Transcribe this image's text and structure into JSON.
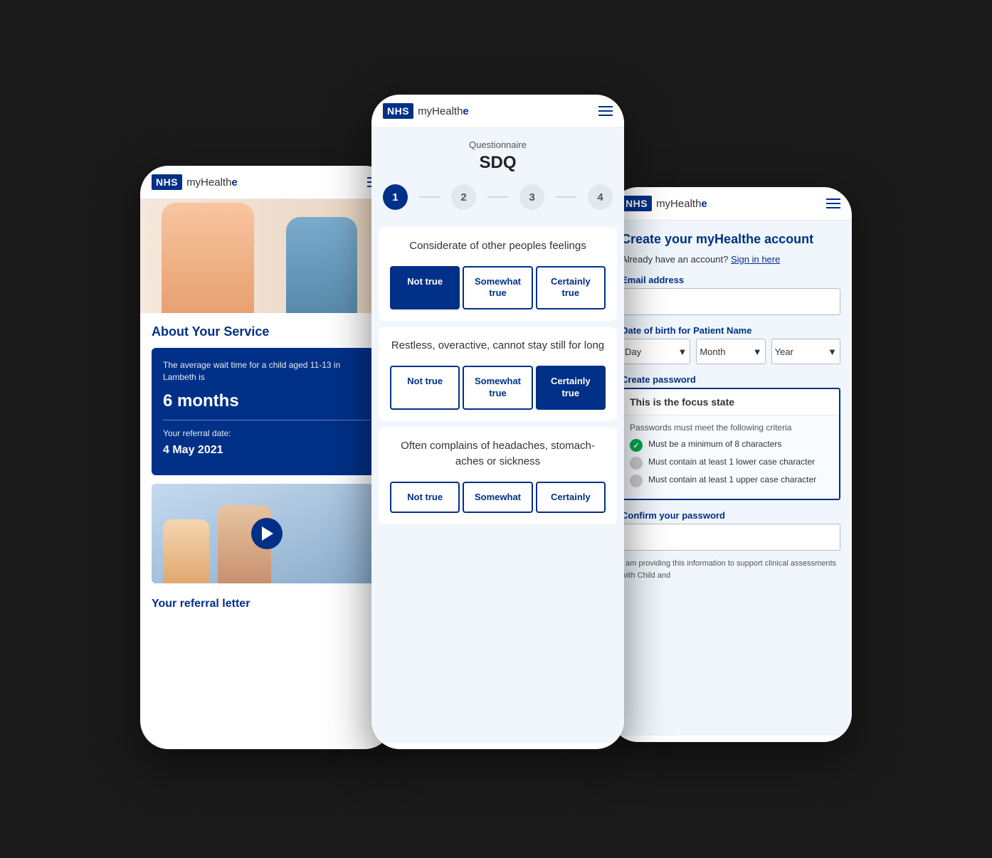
{
  "app": {
    "name": "myHealthe",
    "nhs_badge": "NHS",
    "brand_text": "myHealth",
    "brand_emphasis": "e"
  },
  "phone_left": {
    "header": {
      "logo": "NHS",
      "brand": "myHealthe",
      "menu_icon": "hamburger"
    },
    "about_section": {
      "title": "About Your Service",
      "info_card": {
        "line1": "The average wait time for a child aged 11-13 in Lambeth is",
        "big_value": "6 months",
        "referral_label": "Your referral date:",
        "referral_date": "4 May 2021"
      },
      "referral_link": "Your referral letter"
    }
  },
  "phone_center": {
    "header": {
      "logo": "NHS",
      "brand": "myHealthe",
      "menu_icon": "hamburger"
    },
    "questionnaire": {
      "label": "Questionnaire",
      "title": "SDQ",
      "steps": [
        {
          "number": "1",
          "active": true
        },
        {
          "number": "2",
          "active": false
        },
        {
          "number": "3",
          "active": false
        },
        {
          "number": "4",
          "active": false
        }
      ]
    },
    "questions": [
      {
        "text": "Considerate of other peoples feelings",
        "options": [
          {
            "label": "Not true",
            "selected": true
          },
          {
            "label": "Somewhat true",
            "selected": false
          },
          {
            "label": "Certainly true",
            "selected": false
          }
        ]
      },
      {
        "text": "Restless, overactive, cannot stay still for long",
        "options": [
          {
            "label": "Not true",
            "selected": false
          },
          {
            "label": "Somewhat true",
            "selected": false
          },
          {
            "label": "Certainly true",
            "selected": true
          }
        ]
      },
      {
        "text": "Often complains of headaches, stomach-aches or sickness",
        "options": [
          {
            "label": "Not true",
            "selected": false
          },
          {
            "label": "Somewhat",
            "selected": false
          },
          {
            "label": "Certainly",
            "selected": false
          }
        ]
      }
    ]
  },
  "phone_right": {
    "header": {
      "logo": "NHS",
      "brand": "myHealthe",
      "menu_icon": "hamburger"
    },
    "form": {
      "title": "Create your myHealthe account",
      "subtitle_prefix": "Already have an account?",
      "subtitle_link": "Sign in here",
      "email_label": "Email address",
      "dob_label": "Date of birth for Patient Name",
      "dob_fields": [
        {
          "label": "Day",
          "value": "Day"
        },
        {
          "label": "Month",
          "value": "Month"
        },
        {
          "label": "Year",
          "value": "Year"
        }
      ],
      "password_label": "Create password",
      "password_value": "This is the focus state",
      "password_criteria_title": "Passwords must meet the following criteria",
      "criteria": [
        {
          "text": "Must be a minimum of 8 characters",
          "pass": true
        },
        {
          "text": "Must contain at least 1 lower case character",
          "pass": false
        },
        {
          "text": "Must contain at least 1 upper case character",
          "pass": false
        }
      ],
      "confirm_label": "Confirm your password",
      "consent_text": "I am providing this information to support clinical assessments with Child and"
    }
  }
}
